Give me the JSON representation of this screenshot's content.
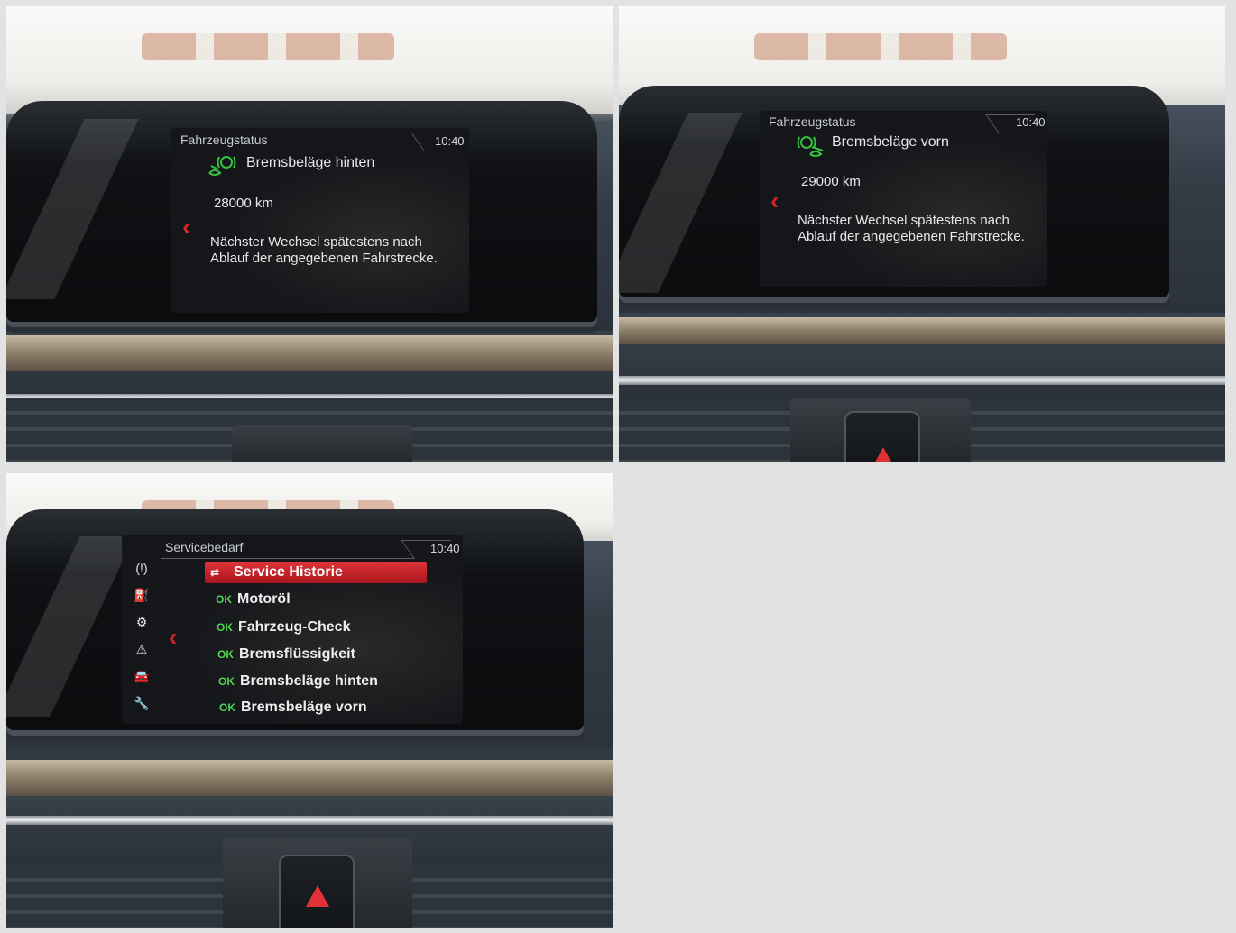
{
  "panels": [
    {
      "header": {
        "title": "Fahrzeugstatus",
        "time": "10:40"
      },
      "item": {
        "icon": "brake-pad-rear-icon",
        "title": "Bremsbeläge hinten",
        "distance": "28000 km",
        "message": "Nächster Wechsel spätestens nach Ablauf der angegebenen Fahrstrecke."
      }
    },
    {
      "header": {
        "title": "Fahrzeugstatus",
        "time": "10:40"
      },
      "item": {
        "icon": "brake-pad-front-icon",
        "title": "Bremsbeläge vorn",
        "distance": "29000 km",
        "message": "Nächster Wechsel spätestens nach Ablauf der angegebenen Fahrstrecke."
      }
    },
    {
      "header": {
        "title": "Servicebedarf",
        "time": "10:40"
      },
      "side_icons": [
        "tire-pressure-icon",
        "oil-can-icon",
        "vehicle-check-icon",
        "warning-triangle-icon",
        "car-service-icon",
        "wrench-icon"
      ],
      "list": [
        {
          "status": "",
          "label": "Service Historie",
          "selected": true,
          "icon": "service-history-icon"
        },
        {
          "status": "OK",
          "label": "Motoröl"
        },
        {
          "status": "OK",
          "label": "Fahrzeug-Check"
        },
        {
          "status": "OK",
          "label": "Bremsflüssigkeit"
        },
        {
          "status": "OK",
          "label": "Bremsbeläge hinten"
        },
        {
          "status": "OK",
          "label": "Bremsbeläge vorn"
        }
      ]
    }
  ],
  "colors": {
    "ok_green": "#4fd44f",
    "icon_green": "#37c13f",
    "accent_red": "#d3232b",
    "hazard_red": "#e03236"
  }
}
